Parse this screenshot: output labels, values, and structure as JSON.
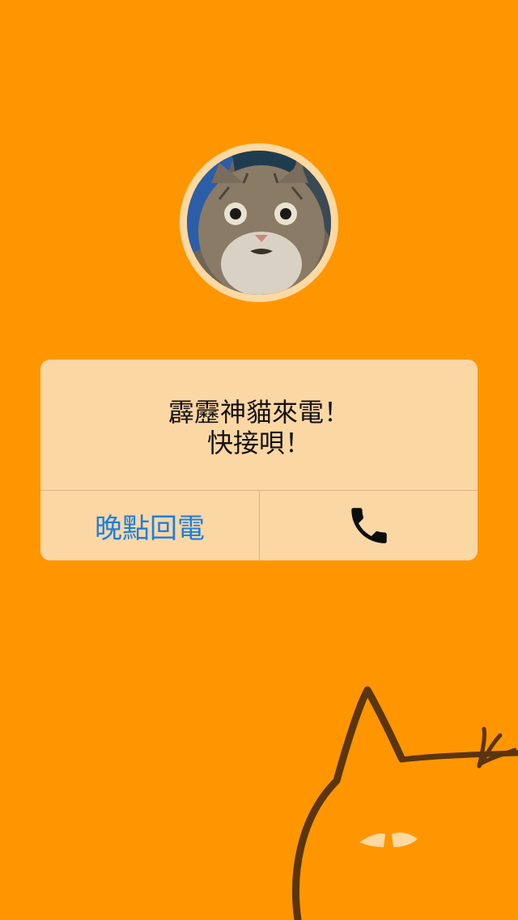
{
  "caller": {
    "avatar_icon": "surprised-cat-photo",
    "message_line1": "霹靂神貓來電！",
    "message_line2": "快接唄！"
  },
  "actions": {
    "later_label": "晚點回電",
    "answer_icon": "phone-icon"
  },
  "colors": {
    "background": "#ff9600",
    "dialog": "#fbd7a4",
    "later_text": "#1a7fe3",
    "doodle_stroke": "#5a3510"
  }
}
